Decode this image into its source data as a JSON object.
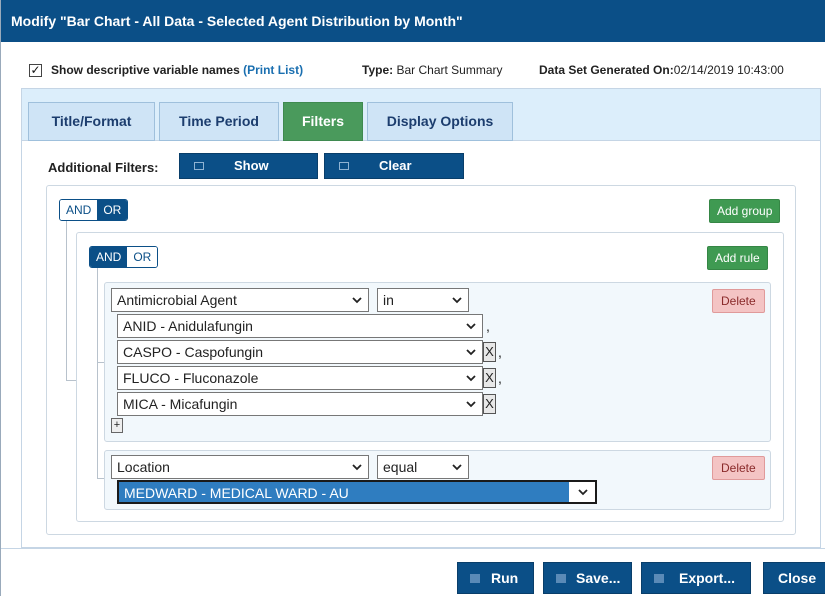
{
  "window": {
    "title": "Modify \"Bar Chart - All Data - Selected Agent Distribution by Month\""
  },
  "meta": {
    "show_names_label": "Show descriptive variable names",
    "print_list_label": "(Print List)",
    "show_names_checked": true,
    "type_label": "Type:",
    "type_value": "Bar Chart Summary",
    "generated_label": "Data Set Generated On:",
    "generated_value": "02/14/2019 10:43:00"
  },
  "tabs": [
    {
      "label": "Title/Format"
    },
    {
      "label": "Time Period"
    },
    {
      "label": "Filters",
      "active": true
    },
    {
      "label": "Display Options"
    }
  ],
  "filters": {
    "label": "Additional Filters:",
    "show_button": "Show",
    "clear_button": "Clear"
  },
  "outer_group": {
    "and": "AND",
    "or": "OR",
    "selected": "OR",
    "add_group": "Add group"
  },
  "inner_group": {
    "and": "AND",
    "or": "OR",
    "selected": "AND",
    "add_rule": "Add rule"
  },
  "rule1": {
    "field": "Antimicrobial Agent",
    "operator": "in",
    "values": [
      "ANID - Anidulafungin",
      "CASPO - Caspofungin",
      "FLUCO - Fluconazole",
      "MICA - Micafungin"
    ],
    "remove_glyph": "X",
    "add_glyph": "+",
    "separator": ",",
    "delete_button": "Delete"
  },
  "rule2": {
    "field": "Location",
    "operator": "equal",
    "value": "MEDWARD - MEDICAL WARD - AU",
    "delete_button": "Delete"
  },
  "footer": {
    "run": "Run",
    "save": "Save...",
    "export": "Export...",
    "close": "Close"
  },
  "colors": {
    "titlebar": "#0b4f87",
    "active_tab": "#4a9a5c",
    "add_button": "#3f9a52",
    "delete_button": "#f4c4c4",
    "selection": "#2f7dc0"
  }
}
